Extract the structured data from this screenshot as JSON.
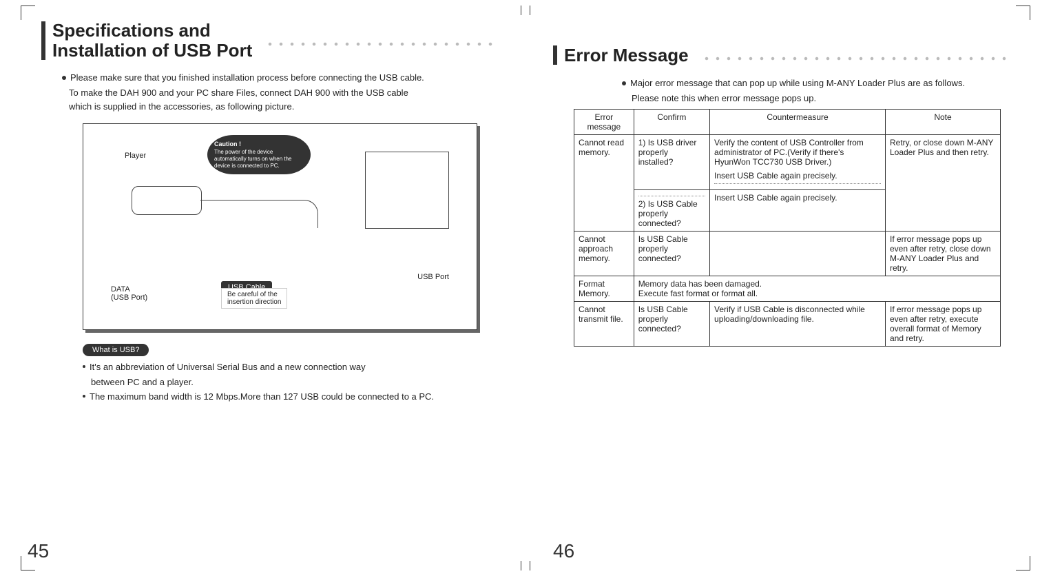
{
  "left": {
    "headline": "Specifications and\nInstallation of USB Port",
    "bullet1": "Please make sure that you finished installation process  before connecting the USB cable.",
    "body1": "To make the DAH 900 and your PC share Files, connect DAH 900 with the USB cable",
    "body2": "which is supplied in the accessories, as following picture.",
    "figure": {
      "player_label": "Player",
      "data_label": "DATA\n(USB Port)",
      "usbport_label": "USB Port",
      "caution_title": "Caution !",
      "caution_body": "The power of the device automatically turns on when the device is connected to PC.",
      "usb_cable_label": "USB Cable",
      "usb_cable_note": "Be careful of the\ninsertion direction"
    },
    "pill": "What is USB?",
    "sub_bullet1": "It's an abbreviation of Universal Serial Bus and a new connection way",
    "sub_bullet1b": "between PC and a player.",
    "sub_bullet2": "The maximum band width is 12 Mbps.More than 127 USB could be connected to a PC.",
    "page_number": "45"
  },
  "right": {
    "headline": "Error Message",
    "intro1": "Major error message that can pop up while using M-ANY Loader Plus are as follows.",
    "intro2": "Please note this when error message pops up.",
    "table": {
      "headers": [
        "Error message",
        "Confirm",
        "Countermeasure",
        "Note"
      ],
      "rows": [
        {
          "err": "Cannot read memory.",
          "confirm_a": "1) Is USB driver properly installed?",
          "counter_a": "Verify the content of USB Controller from administrator of PC.(Verify if there's HyunWon TCC730 USB Driver.)",
          "counter_a2": "Insert USB Cable again precisely.",
          "confirm_b": "2) Is USB Cable properly connected?",
          "counter_b": "Insert USB Cable again precisely.",
          "note": "Retry, or close down M-ANY Loader Plus and then retry."
        },
        {
          "err": "Cannot approach memory.",
          "confirm": "Is USB Cable properly connected?",
          "counter": "",
          "note": "If error message pops up even after retry, close down M-ANY Loader Plus and retry."
        },
        {
          "err": "Format Memory.",
          "merged": "Memory data has been damaged.\nExecute fast format or format all."
        },
        {
          "err": "Cannot transmit file.",
          "confirm": "Is USB Cable properly connected?",
          "counter": "Verify if USB Cable is disconnected while uploading/downloading file.",
          "note": "If error message pops up even after retry, execute overall format of Memory and retry."
        }
      ]
    },
    "page_number": "46"
  }
}
